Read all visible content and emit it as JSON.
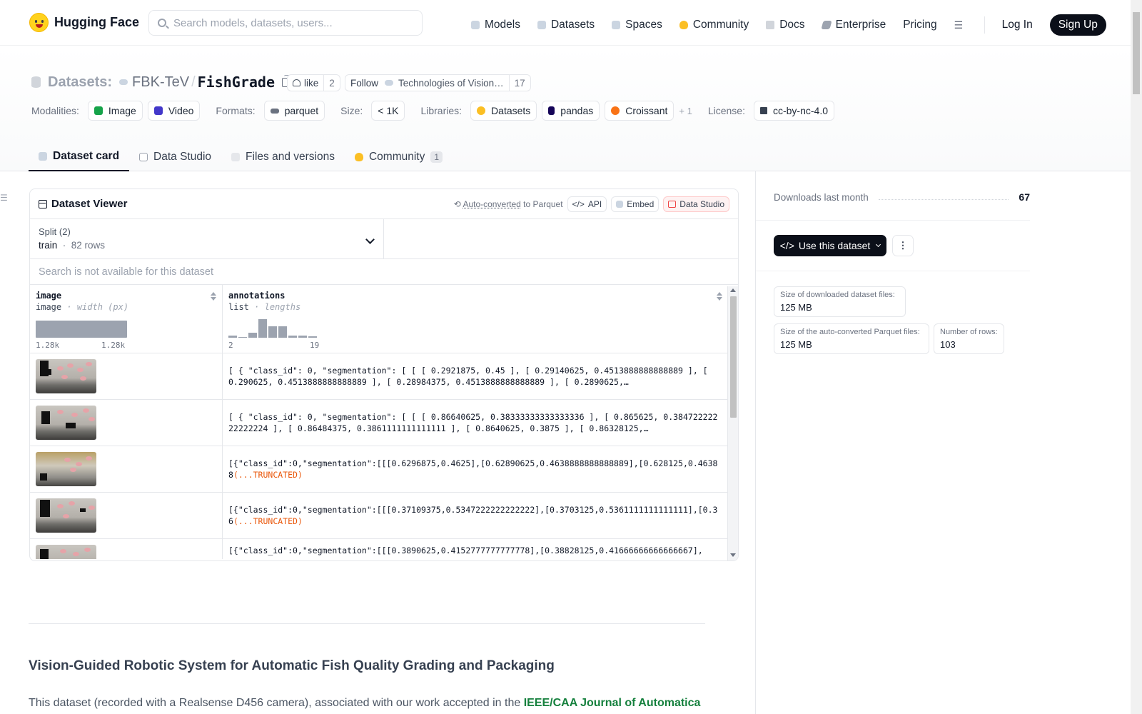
{
  "nav": {
    "brand": "Hugging Face",
    "search_placeholder": "Search models, datasets, users...",
    "links": [
      "Models",
      "Datasets",
      "Spaces",
      "Community",
      "Docs",
      "Enterprise",
      "Pricing"
    ],
    "login": "Log In",
    "signup": "Sign Up"
  },
  "repo": {
    "kind": "Datasets:",
    "org": "FBK-TeV",
    "name": "FishGrade",
    "like_label": "like",
    "like_count": "2",
    "follow_label": "Follow",
    "org_full": "Technologies of Vision…",
    "follow_count": "17"
  },
  "meta": {
    "modalities_label": "Modalities:",
    "modalities": [
      "Image",
      "Video"
    ],
    "formats_label": "Formats:",
    "formats": [
      "parquet"
    ],
    "size_label": "Size:",
    "size": "< 1K",
    "libraries_label": "Libraries:",
    "libraries": [
      "Datasets",
      "pandas",
      "Croissant"
    ],
    "libraries_more": "+ 1",
    "license_label": "License:",
    "license": "cc-by-nc-4.0"
  },
  "tabs": [
    {
      "label": "Dataset card",
      "active": true
    },
    {
      "label": "Data Studio"
    },
    {
      "label": "Files and versions"
    },
    {
      "label": "Community",
      "badge": "1"
    }
  ],
  "viewer": {
    "title": "Dataset Viewer",
    "auto_converted": "Auto-converted",
    "to_parquet": "to Parquet",
    "api": "API",
    "embed": "Embed",
    "data_studio": "Data Studio",
    "split_label": "Split (2)",
    "split_name": "train",
    "split_rows": "82 rows",
    "search_na": "Search is not available for this dataset",
    "columns": [
      {
        "name": "image",
        "type": "image",
        "stat": "width (px)",
        "min": "1.28k",
        "max": "1.28k"
      },
      {
        "name": "annotations",
        "type": "list",
        "stat": "lengths",
        "min": "2",
        "max": "19"
      }
    ],
    "annotations_hist": [
      1,
      0,
      2,
      8,
      5,
      5,
      1,
      1,
      0.5
    ],
    "rows": [
      {
        "text": "[ { \"class_id\": 0, \"segmentation\": [ [ [ 0.2921875, 0.45 ], [ 0.29140625, 0.4513888888888889 ], [ 0.290625, 0.4513888888888889 ], [ 0.28984375, 0.4513888888888889 ], [ 0.2890625,…",
        "truncated": ""
      },
      {
        "text": "[ { \"class_id\": 0, \"segmentation\": [ [ [ 0.86640625, 0.38333333333333336 ], [ 0.865625, 0.38472222222222224 ], [ 0.86484375, 0.3861111111111111 ], [ 0.8640625, 0.3875 ], [ 0.86328125,…",
        "truncated": ""
      },
      {
        "text": "[{\"class_id\":0,\"segmentation\":[[[0.6296875,0.4625],[0.62890625,0.4638888888888889],[0.628125,0.46388",
        "truncated": "(...TRUNCATED)"
      },
      {
        "text": "[{\"class_id\":0,\"segmentation\":[[[0.37109375,0.5347222222222222],[0.3703125,0.5361111111111111],[0.36",
        "truncated": "(...TRUNCATED)"
      },
      {
        "text": "[{\"class_id\":0,\"segmentation\":[[[0.3890625,0.4152777777777778],[0.38828125,0.41666666666666667],",
        "truncated": ""
      }
    ]
  },
  "article": {
    "title": "Vision-Guided Robotic System for Automatic Fish Quality Grading and Packaging",
    "para_prefix": "This dataset (recorded with a Realsense D456 camera), associated with our work accepted in the ",
    "para_link": "IEEE/CAA Journal of Automatica"
  },
  "sidebar": {
    "downloads_label": "Downloads last month",
    "downloads_value": "67",
    "use_button": "Use this dataset",
    "stats": [
      {
        "label": "Size of downloaded dataset files:",
        "value": "125 MB"
      },
      {
        "label": "Size of the auto-converted Parquet files:",
        "value": "125 MB"
      },
      {
        "label": "Number of rows:",
        "value": "103"
      }
    ]
  },
  "colors": {
    "primary_dark": "#0b0f19",
    "link_green": "#15803d",
    "truncated_orange": "#ea580c",
    "hist_bar": "#9ca3af"
  }
}
